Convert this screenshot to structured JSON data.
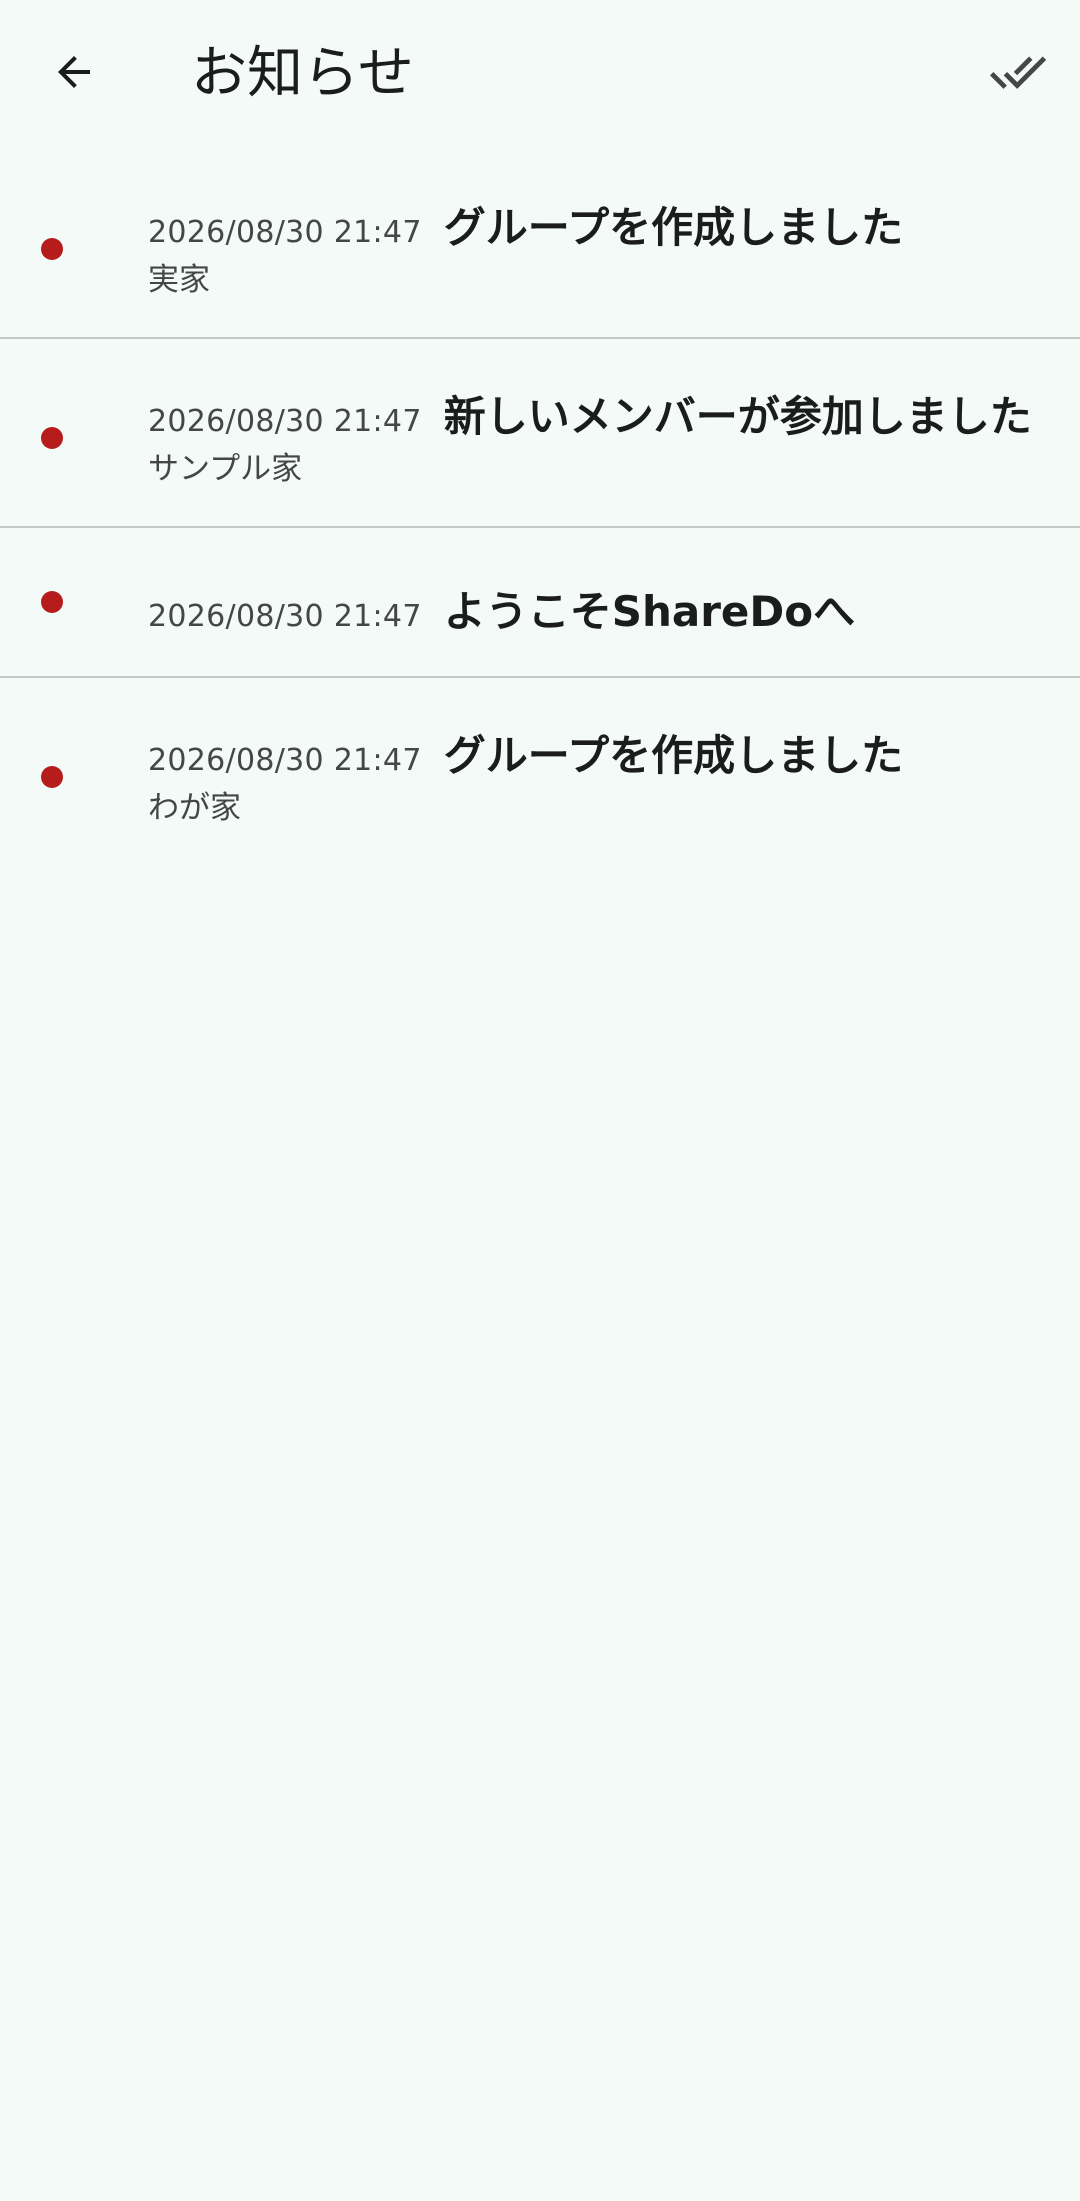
{
  "header": {
    "title": "お知らせ",
    "back_icon": "arrow-back-icon",
    "mark_all_icon": "double-check-icon"
  },
  "colors": {
    "unread_dot": "#b71c1c",
    "background": "#f4faf8",
    "divider": "#c4c7c5"
  },
  "notifications": [
    {
      "time": "2026/08/30 21:47",
      "title": "グループを作成しました",
      "group": "実家",
      "unread": true
    },
    {
      "time": "2026/08/30 21:47",
      "title": "新しいメンバーが参加しました",
      "group": "サンプル家",
      "unread": true
    },
    {
      "time": "2026/08/30 21:47",
      "title": "ようこそShareDoへ",
      "group": "",
      "unread": true
    },
    {
      "time": "2026/08/30 21:47",
      "title": "グループを作成しました",
      "group": "わが家",
      "unread": true
    }
  ]
}
